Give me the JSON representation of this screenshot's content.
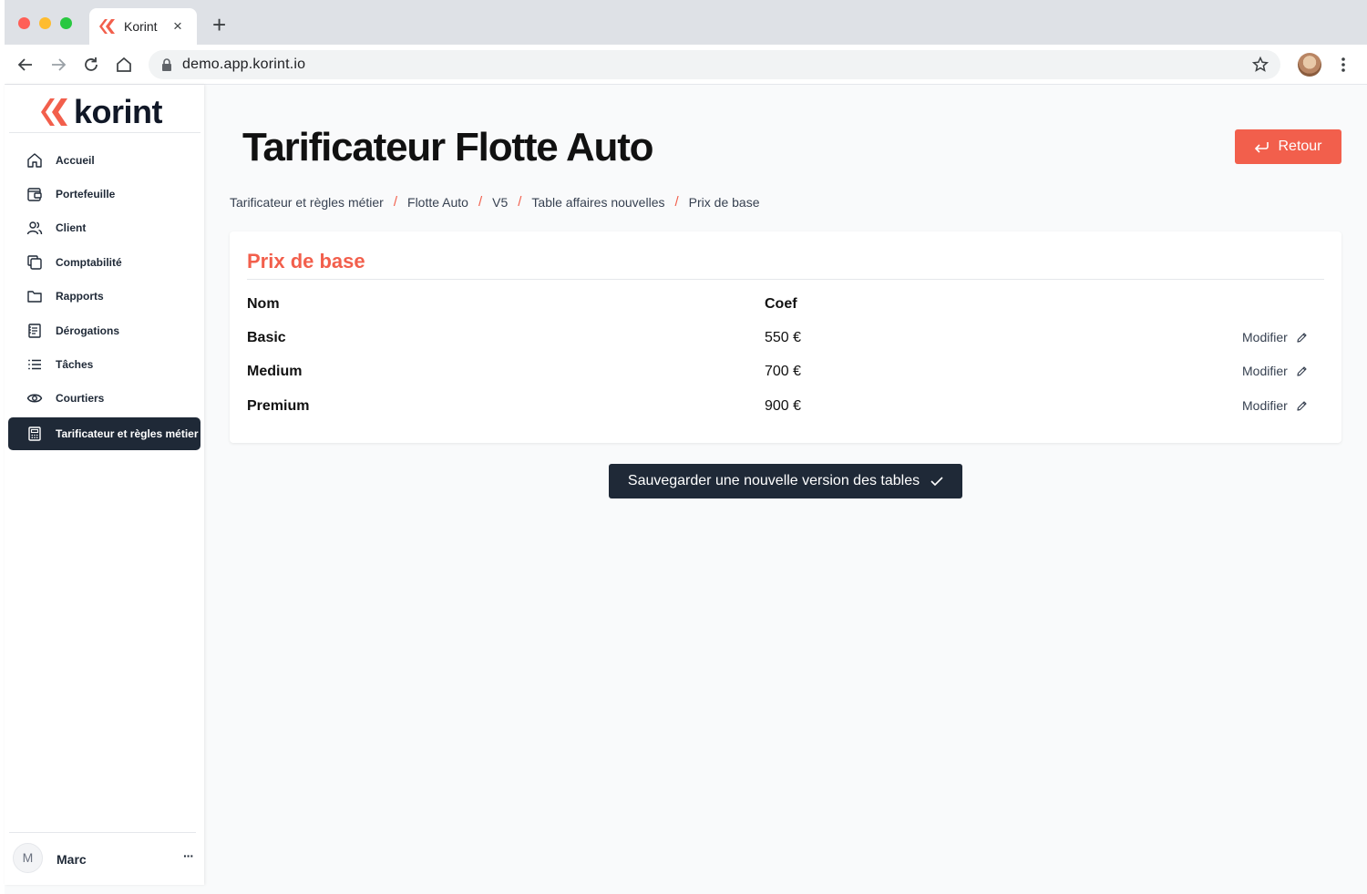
{
  "browser": {
    "tab_title": "Korint",
    "tab_close": "×",
    "new_tab": "+",
    "url": "demo.app.korint.io"
  },
  "sidebar": {
    "logo_text": "korint",
    "items": [
      {
        "label": "Accueil",
        "icon": "home-icon"
      },
      {
        "label": "Portefeuille",
        "icon": "wallet-icon"
      },
      {
        "label": "Client",
        "icon": "users-icon"
      },
      {
        "label": "Comptabilité",
        "icon": "copy-icon"
      },
      {
        "label": "Rapports",
        "icon": "folder-icon"
      },
      {
        "label": "Dérogations",
        "icon": "document-icon"
      },
      {
        "label": "Tâches",
        "icon": "list-icon"
      },
      {
        "label": "Courtiers",
        "icon": "eye-icon"
      },
      {
        "label": "Tarificateur et règles métier",
        "icon": "calculator-icon",
        "active": true
      }
    ],
    "user": {
      "initial": "M",
      "name": "Marc",
      "more": "···"
    }
  },
  "main": {
    "title": "Tarificateur Flotte Auto",
    "back_button": "Retour",
    "breadcrumb": [
      "Tarificateur et règles métier",
      "Flotte Auto",
      "V5",
      "Table affaires nouvelles",
      "Prix de base"
    ],
    "breadcrumb_sep": "/",
    "card": {
      "title": "Prix de base",
      "columns": [
        "Nom",
        "Coef"
      ],
      "rows": [
        {
          "name": "Basic",
          "value": "550 €",
          "action": "Modifier"
        },
        {
          "name": "Medium",
          "value": "700 €",
          "action": "Modifier"
        },
        {
          "name": "Premium",
          "value": "900 €",
          "action": "Modifier"
        }
      ]
    },
    "save_button": "Sauvegarder une nouvelle version des tables"
  },
  "colors": {
    "accent": "#f25f4c",
    "dark": "#1f2937"
  }
}
